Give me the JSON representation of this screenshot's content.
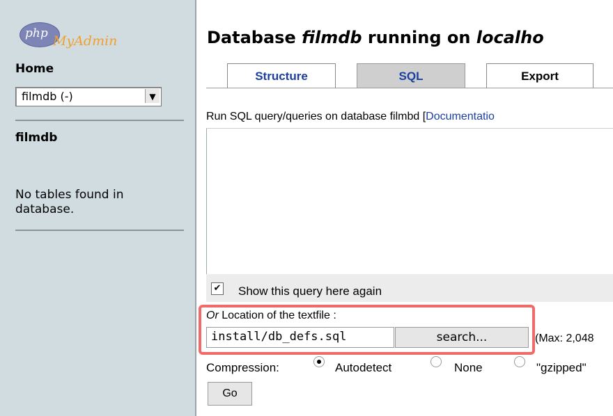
{
  "nav": {
    "logo_php": "php",
    "logo_myadmin": "MyAdmin",
    "home": "Home",
    "db_select_value": "filmdb (-)",
    "db_name": "filmdb",
    "no_tables": "No tables found in database."
  },
  "main": {
    "title_prefix": "Database ",
    "title_db": "filmdb",
    "title_mid": " running on ",
    "title_host": "localho",
    "tabs": [
      {
        "label": "Structure"
      },
      {
        "label": "SQL"
      },
      {
        "label": "Export"
      }
    ],
    "run_sql_text": "Run SQL query/queries on database filmbd [",
    "documentation_link": "Documentatio",
    "query_text": "",
    "show_query_label": "Show this query here again",
    "location_or": "Or",
    "location_label": " Location of the textfile :",
    "file_value": "install/db_defs.sql",
    "search_button": "search...",
    "max_label": "(Max: 2,048",
    "compression_label": "Compression:",
    "compression_options": [
      {
        "label": "Autodetect",
        "selected": true
      },
      {
        "label": "None",
        "selected": false
      },
      {
        "label": "\"gzipped\"",
        "selected": false
      }
    ],
    "go_button": "Go"
  },
  "colors": {
    "nav_bg": "#d0dce0",
    "link": "#1b3fa0",
    "highlight": "#f06a6a",
    "active_tab": "#cfcfcf"
  }
}
